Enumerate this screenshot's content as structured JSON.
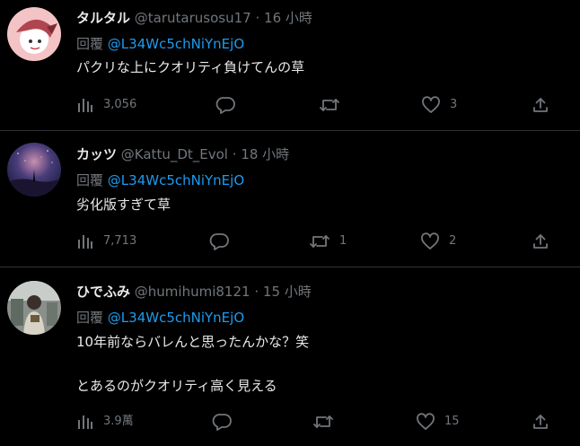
{
  "reply_prefix": "回覆",
  "tweets": [
    {
      "display_name": "タルタル",
      "handle": "@tarutarusosu17",
      "separator": "·",
      "time": "16 小時",
      "reply_to": "@L34Wc5chNiYnEjO",
      "lines": [
        "パクリな上にクオリティ負けてんの草"
      ],
      "views": "3,056",
      "replies": "",
      "retweets": "",
      "likes": "3"
    },
    {
      "display_name": "カッツ",
      "handle": "@Kattu_Dt_Evol",
      "separator": "·",
      "time": "18 小時",
      "reply_to": "@L34Wc5chNiYnEjO",
      "lines": [
        "劣化版すぎて草"
      ],
      "views": "7,713",
      "replies": "",
      "retweets": "1",
      "likes": "2"
    },
    {
      "display_name": "ひでふみ",
      "handle": "@humihumi8121",
      "separator": "·",
      "time": "15 小時",
      "reply_to": "@L34Wc5chNiYnEjO",
      "lines": [
        "10年前ならバレんと思ったんかな？笑",
        "とあるのがクオリティ高く見える"
      ],
      "views": "3.9萬",
      "replies": "",
      "retweets": "",
      "likes": "15"
    }
  ],
  "icons": {
    "views": "bar-chart-icon",
    "reply": "speech-bubble-icon",
    "retweet": "retweet-arrows-icon",
    "like": "heart-icon",
    "share": "upload-share-icon"
  },
  "colors": {
    "background": "#000000",
    "text": "#e7e9ea",
    "muted": "#71767b",
    "link": "#1d9bf0",
    "divider": "#2f3336"
  }
}
